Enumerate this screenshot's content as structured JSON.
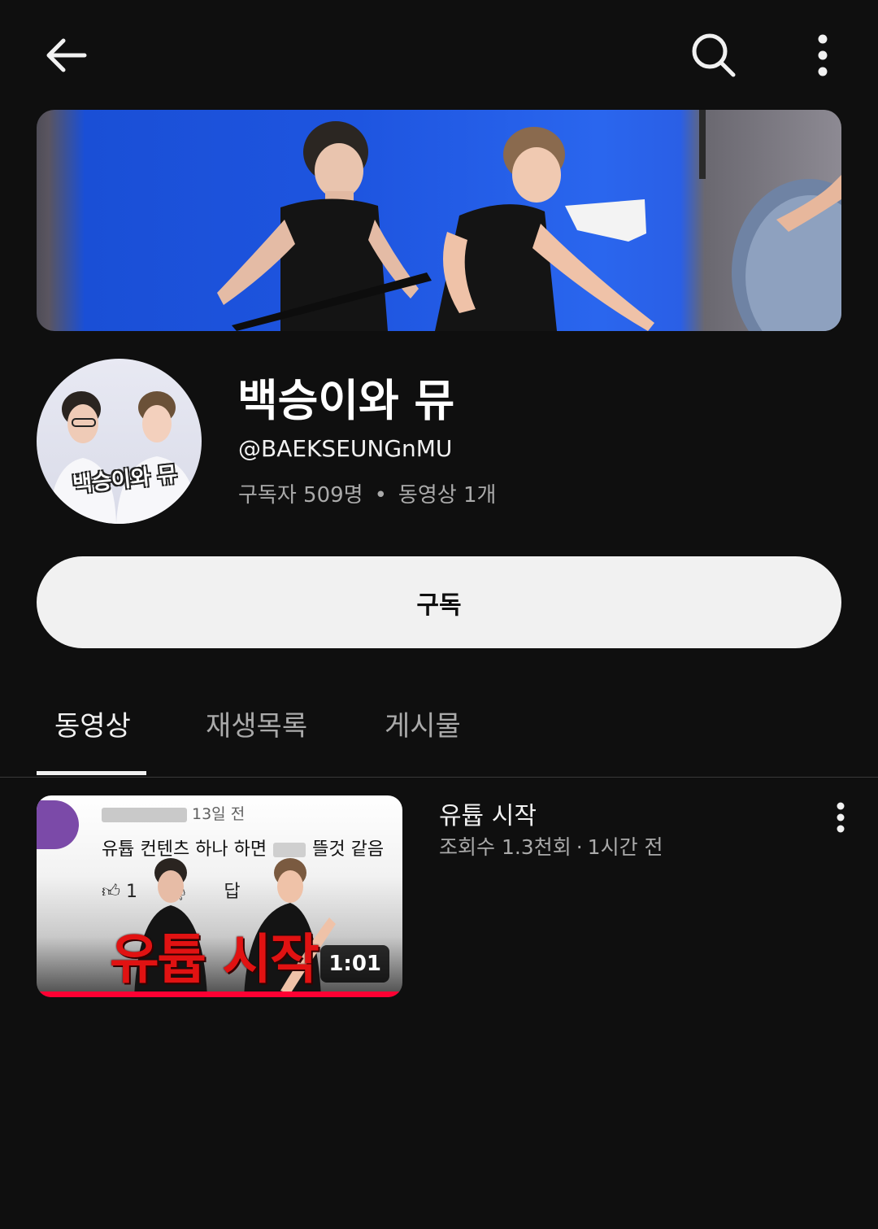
{
  "icons": {
    "back": "arrow-left-icon",
    "search": "search-icon",
    "more": "more-vert-icon"
  },
  "channel": {
    "name": "백승이와 뮤",
    "handle": "@BAEKSEUNGnMU",
    "subscribers": "구독자 509명",
    "stats_separator": "•",
    "videos": "동영상 1개",
    "avatar_logo_text": "백승이와 뮤"
  },
  "subscribe": {
    "label": "구독"
  },
  "tabs": [
    {
      "label": "동영상",
      "active": true
    },
    {
      "label": "재생목록",
      "active": false
    },
    {
      "label": "게시물",
      "active": false
    }
  ],
  "videos": [
    {
      "title": "유튭 시작",
      "views": "조회수 1.3천회",
      "separator": "·",
      "age": "1시간 전",
      "duration": "1:01",
      "watched_progress": 1.0,
      "thumbnail": {
        "comment_time": "13일 전",
        "comment_text_start": "유튭 컨텐츠 하나 하면",
        "comment_text_end": "뜰것 같음",
        "like_count": "1",
        "reply_label": "답",
        "overlay_title": "유튭 시작"
      }
    }
  ],
  "colors": {
    "background": "#0f0f0f",
    "subscribe_bg": "#f1f1f1",
    "progress": "#ff0033",
    "thumb_title": "#e11212"
  }
}
